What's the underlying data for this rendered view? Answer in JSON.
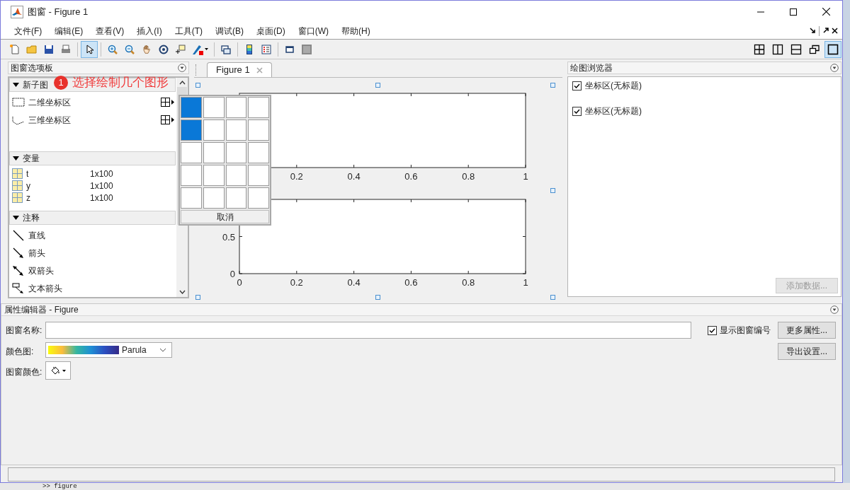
{
  "window": {
    "title": "图窗 - Figure 1"
  },
  "menu": [
    "文件(F)",
    "编辑(E)",
    "查看(V)",
    "插入(I)",
    "工具(T)",
    "调试(B)",
    "桌面(D)",
    "窗口(W)",
    "帮助(H)"
  ],
  "toolbar": {
    "groups": [
      [
        {
          "kind": "new",
          "selected": false
        },
        {
          "kind": "open",
          "selected": false
        },
        {
          "kind": "save",
          "selected": false
        },
        {
          "kind": "print",
          "selected": false
        }
      ],
      [
        {
          "kind": "pointer",
          "selected": true
        }
      ],
      [
        {
          "kind": "zoomin",
          "selected": false
        },
        {
          "kind": "zoomout",
          "selected": false
        },
        {
          "kind": "pan",
          "selected": false
        },
        {
          "kind": "rotate",
          "selected": false
        },
        {
          "kind": "datatip",
          "selected": false
        },
        {
          "kind": "brush",
          "selected": false
        }
      ],
      [
        {
          "kind": "link",
          "selected": false
        }
      ],
      [
        {
          "kind": "colorbar",
          "selected": false
        },
        {
          "kind": "legend",
          "selected": false
        }
      ],
      [
        {
          "kind": "dock",
          "selected": false
        },
        {
          "kind": "panel",
          "selected": false
        }
      ]
    ],
    "layouts": [
      {
        "kind": "grid",
        "selected": false
      },
      {
        "kind": "cols",
        "selected": false
      },
      {
        "kind": "rows",
        "selected": false
      },
      {
        "kind": "float",
        "selected": false
      },
      {
        "kind": "single",
        "selected": true
      }
    ]
  },
  "palette": {
    "title": "图窗选项板",
    "sections": [
      {
        "title": "新子图",
        "expanded": true,
        "items": [
          {
            "kind": "axes2d",
            "label": "二维坐标区"
          },
          {
            "kind": "axes3d",
            "label": "三维坐标区"
          }
        ]
      },
      {
        "title": "变量",
        "expanded": true,
        "variables": [
          {
            "name": "t",
            "size": "1x100"
          },
          {
            "name": "y",
            "size": "1x100"
          },
          {
            "name": "z",
            "size": "1x100"
          }
        ]
      },
      {
        "title": "注释",
        "expanded": true,
        "items": [
          {
            "kind": "line",
            "label": "直线"
          },
          {
            "kind": "arrow",
            "label": "箭头"
          },
          {
            "kind": "double-arrow",
            "label": "双箭头"
          },
          {
            "kind": "text-arrow",
            "label": "文本箭头"
          }
        ]
      }
    ]
  },
  "annotation": {
    "badge": "1",
    "text": "选择绘制几个图形"
  },
  "subplot_picker": {
    "rows": [
      [
        {
          "selected": true
        },
        {
          "selected": false
        },
        {
          "selected": false
        },
        {
          "selected": false
        }
      ],
      [
        {
          "selected": true
        },
        {
          "selected": false
        },
        {
          "selected": false
        },
        {
          "selected": false
        }
      ],
      [
        {
          "selected": false
        },
        {
          "selected": false
        },
        {
          "selected": false
        },
        {
          "selected": false
        }
      ],
      [
        {
          "selected": false
        },
        {
          "selected": false
        },
        {
          "selected": false
        },
        {
          "selected": false
        }
      ],
      [
        {
          "selected": false
        },
        {
          "selected": false
        },
        {
          "selected": false
        },
        {
          "selected": false
        }
      ]
    ],
    "cancel": "取消"
  },
  "figure_tab": {
    "label": "Figure 1",
    "selected": true
  },
  "axes": [
    {
      "chart_data": {
        "type": "line",
        "xlim": [
          0,
          1
        ],
        "ylim": [
          0,
          1
        ],
        "xticks": [
          0.2,
          0.4,
          0.6,
          0.8,
          1
        ]
      }
    },
    {
      "chart_data": {
        "type": "line",
        "xlim": [
          0,
          1
        ],
        "ylim": [
          0,
          1
        ],
        "xticks": [
          0,
          0.2,
          0.4,
          0.6,
          0.8,
          1
        ],
        "yticks": [
          0,
          0.5
        ]
      }
    }
  ],
  "plot_browser": {
    "title": "绘图浏览器",
    "items": [
      {
        "label": "坐标区(无标题)",
        "checked": true
      },
      {
        "label": "坐标区(无标题)",
        "checked": true
      }
    ],
    "add_button": {
      "label": "添加数据...",
      "disabled": true
    }
  },
  "property_editor": {
    "title": "属性编辑器 - Figure",
    "name_label": "图窗名称:",
    "show_number": {
      "label": "显示图窗编号",
      "checked": true
    },
    "more_button": "更多属性...",
    "colormap_label": "颜色图:",
    "colormap": "Parula",
    "export_button": "导出设置...",
    "color_label": "图窗颜色:"
  },
  "console": ">> figure"
}
